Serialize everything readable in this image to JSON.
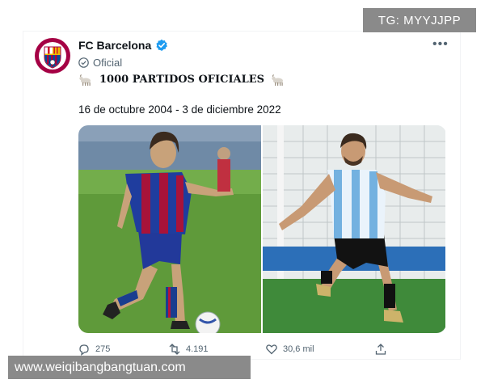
{
  "watermark": {
    "tg": "TG: MYYJJPP",
    "site": "www.weiqibangbangtuan.com"
  },
  "tweet": {
    "account_name": "FC Barcelona",
    "badge_label": "Oficial",
    "text": "1000 PARTIDOS OFICIALES",
    "dates": "16 de octubre 2004 - 3 de diciembre 2022",
    "icons": [
      "barcelona-crest",
      "verified-badge",
      "official-check",
      "goat-emoji",
      "more-dots"
    ],
    "photos": [
      "messi-barcelona-2004",
      "messi-argentina-2022"
    ]
  },
  "actions": {
    "replies": "275",
    "retweets": "4.191",
    "likes": "30,6 mil"
  },
  "colors": {
    "verified": "#1d9bf0",
    "barca_red": "#a50044",
    "barca_blue": "#004d98"
  }
}
